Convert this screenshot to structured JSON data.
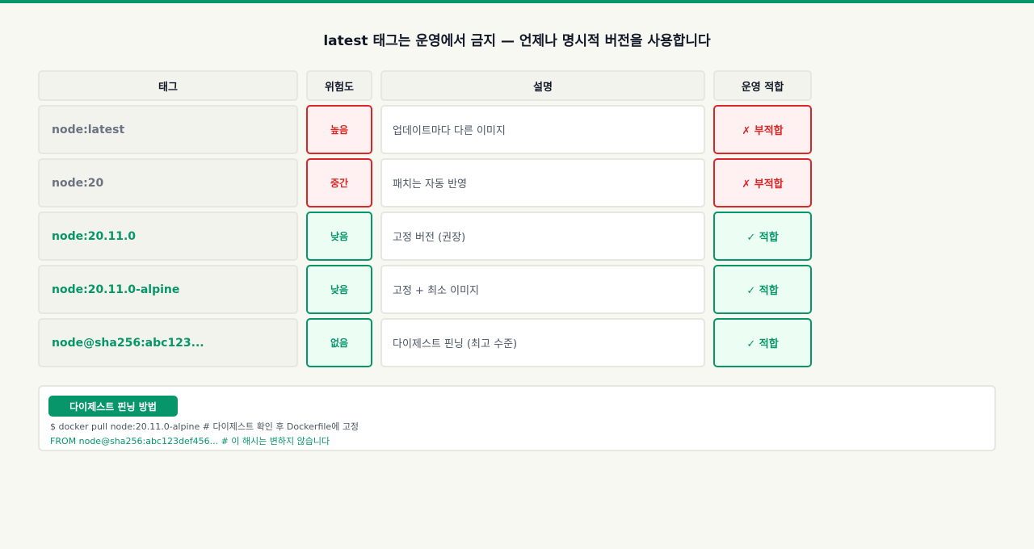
{
  "title": "latest 태그는 운영에서 금지 — 언제나 명시적 버전을 사용합니다",
  "colors": {
    "accent": "#079669",
    "danger": "#dc2626"
  },
  "table": {
    "headers": [
      "태그",
      "위험도",
      "설명",
      "운영 적합"
    ],
    "rows": [
      {
        "tag": "node:latest",
        "risk": "높음",
        "desc": "업데이트마다 다른 이미지",
        "fit": "✗ 부적합",
        "ok": false
      },
      {
        "tag": "node:20",
        "risk": "중간",
        "desc": "패치는 자동 반영",
        "fit": "✗ 부적합",
        "ok": false
      },
      {
        "tag": "node:20.11.0",
        "risk": "낮음",
        "desc": "고정 버전 (권장)",
        "fit": "✓ 적합",
        "ok": true
      },
      {
        "tag": "node:20.11.0-alpine",
        "risk": "낮음",
        "desc": "고정 + 최소 이미지",
        "fit": "✓ 적합",
        "ok": true
      },
      {
        "tag": "node@sha256:abc123...",
        "risk": "없음",
        "desc": "다이제스트 핀닝 (최고 수준)",
        "fit": "✓ 적합",
        "ok": true
      }
    ]
  },
  "panel": {
    "badge": "다이제스트 핀닝 방법",
    "line1": "$ docker pull node:20.11.0-alpine # 다이제스트 확인 후 Dockerfile에 고정",
    "line2": "FROM node@sha256:abc123def456... # 이 해시는 변하지 않습니다"
  }
}
